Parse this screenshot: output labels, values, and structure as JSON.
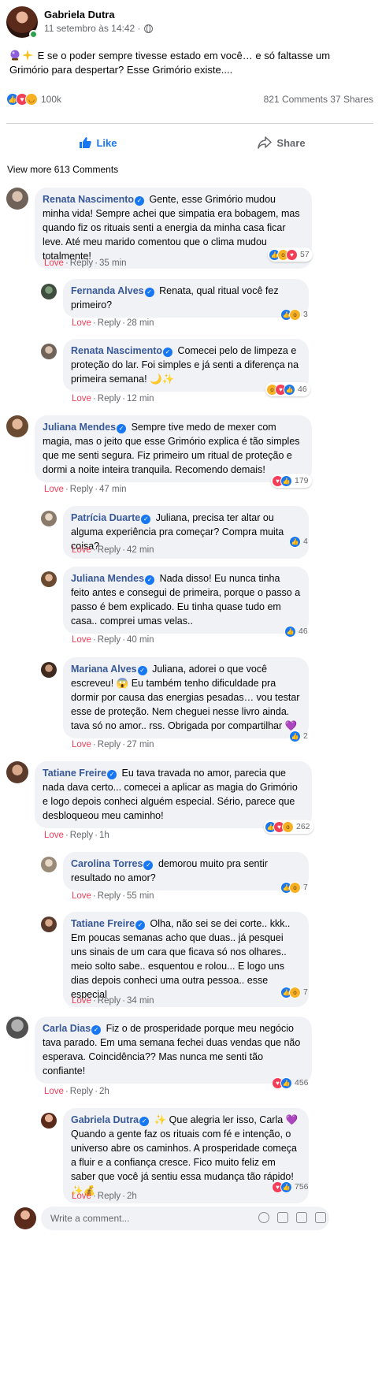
{
  "post": {
    "author": "Gabriela Dutra",
    "timestamp": "11 setembro às 14:42 · ",
    "text": "E se o poder sempre tivesse estado em você… e só faltasse um Grimório para despertar? Esse Grimório existe....",
    "reaction_count": "100k",
    "stats": "821 Comments 37 Shares"
  },
  "actions": {
    "like": "Like",
    "share": "Share"
  },
  "view_more": "View more 613 Comments",
  "comments": [
    {
      "name": "Renata Nascimento",
      "text": "Gente, esse Grimório mudou minha vida! Sempre achei que simpatia era bobagem, mas quando fiz os rituais senti a energia da minha casa ficar leve. Até meu marido comentou que o clima mudou totalmente!",
      "time": "35 min",
      "reactions": "57"
    },
    {
      "name": "Fernanda Alves",
      "text": "Renata, qual ritual você fez primeiro?",
      "time": "28 min",
      "reactions": "3"
    },
    {
      "name": "Renata Nascimento",
      "text": "Comecei pelo de limpeza e proteção do lar. Foi simples e já senti a diferença na primeira semana! 🌙✨",
      "time": "12 min",
      "reactions": "46"
    },
    {
      "name": "Juliana Mendes",
      "text": "Sempre tive medo de mexer com magia, mas o jeito que esse Grimório explica é tão simples que me senti segura. Fiz primeiro um ritual de proteção e dormi a noite inteira tranquila. Recomendo demais!",
      "time": "47 min",
      "reactions": "179"
    },
    {
      "name": "Patrícia Duarte",
      "text": "Juliana, precisa ter altar ou alguma experiência pra começar? Compra muita coisa?",
      "time": "42 min",
      "reactions": "4"
    },
    {
      "name": "Juliana Mendes",
      "text": "Nada disso! Eu nunca tinha feito antes e consegui de primeira, porque o passo a passo é bem explicado. Eu tinha quase tudo em casa.. comprei umas velas..",
      "time": "40 min",
      "reactions": "46"
    },
    {
      "name": "Mariana Alves",
      "text": "Juliana, adorei o que você escreveu! 😱 Eu também tenho dificuldade pra dormir por causa das energias pesadas… vou testar esse de proteção. Nem cheguei nesse livro ainda. tava só no amor.. rss. Obrigada por compartilhar 💜",
      "time": "27 min",
      "reactions": "2"
    },
    {
      "name": "Tatiane Freire",
      "text": "Eu tava travada no amor, parecia que nada dava certo... comecei a aplicar as magia do Grimório e logo depois conheci alguém especial. Sério, parece que desbloqueou meu caminho!",
      "time": "1h",
      "reactions": "262"
    },
    {
      "name": "Carolina Torres",
      "text": "demorou muito pra sentir resultado no amor?",
      "time": "55 min",
      "reactions": "7"
    },
    {
      "name": "Tatiane Freire",
      "text": "Olha, não sei se dei corte.. kkk.. Em poucas semanas acho que duas.. já pesquei uns sinais de um cara que ficava só nos olhares.. meio solto sabe.. esquentou e rolou... E logo uns dias depois conheci uma outra pessoa.. esse especial",
      "time": "34 min",
      "reactions": "7"
    },
    {
      "name": "Carla Dias",
      "text": "Fiz o de prosperidade porque meu negócio tava parado. Em uma semana fechei duas vendas que não esperava. Coincidência?? Mas nunca me senti tão confiante!",
      "time": "2h",
      "reactions": "456"
    },
    {
      "name": "Gabriela Dutra",
      "text": "✨ Que alegria ler isso, Carla 💜 Quando a gente faz os rituais com fé e intenção, o universo abre os caminhos. A prosperidade começa a fluir e a confiança cresce. Fico muito feliz em saber que você já sentiu essa mudança tão rápido! ✨💰",
      "time": "2h",
      "reactions": "756"
    }
  ],
  "comment_actions": {
    "love": "Love",
    "reply": "Reply"
  },
  "write_placeholder": "Write a comment...",
  "colors": {
    "brand": "#1877f2",
    "name": "#385898",
    "love": "#f33e58",
    "bubble": "#f0f2f5"
  }
}
